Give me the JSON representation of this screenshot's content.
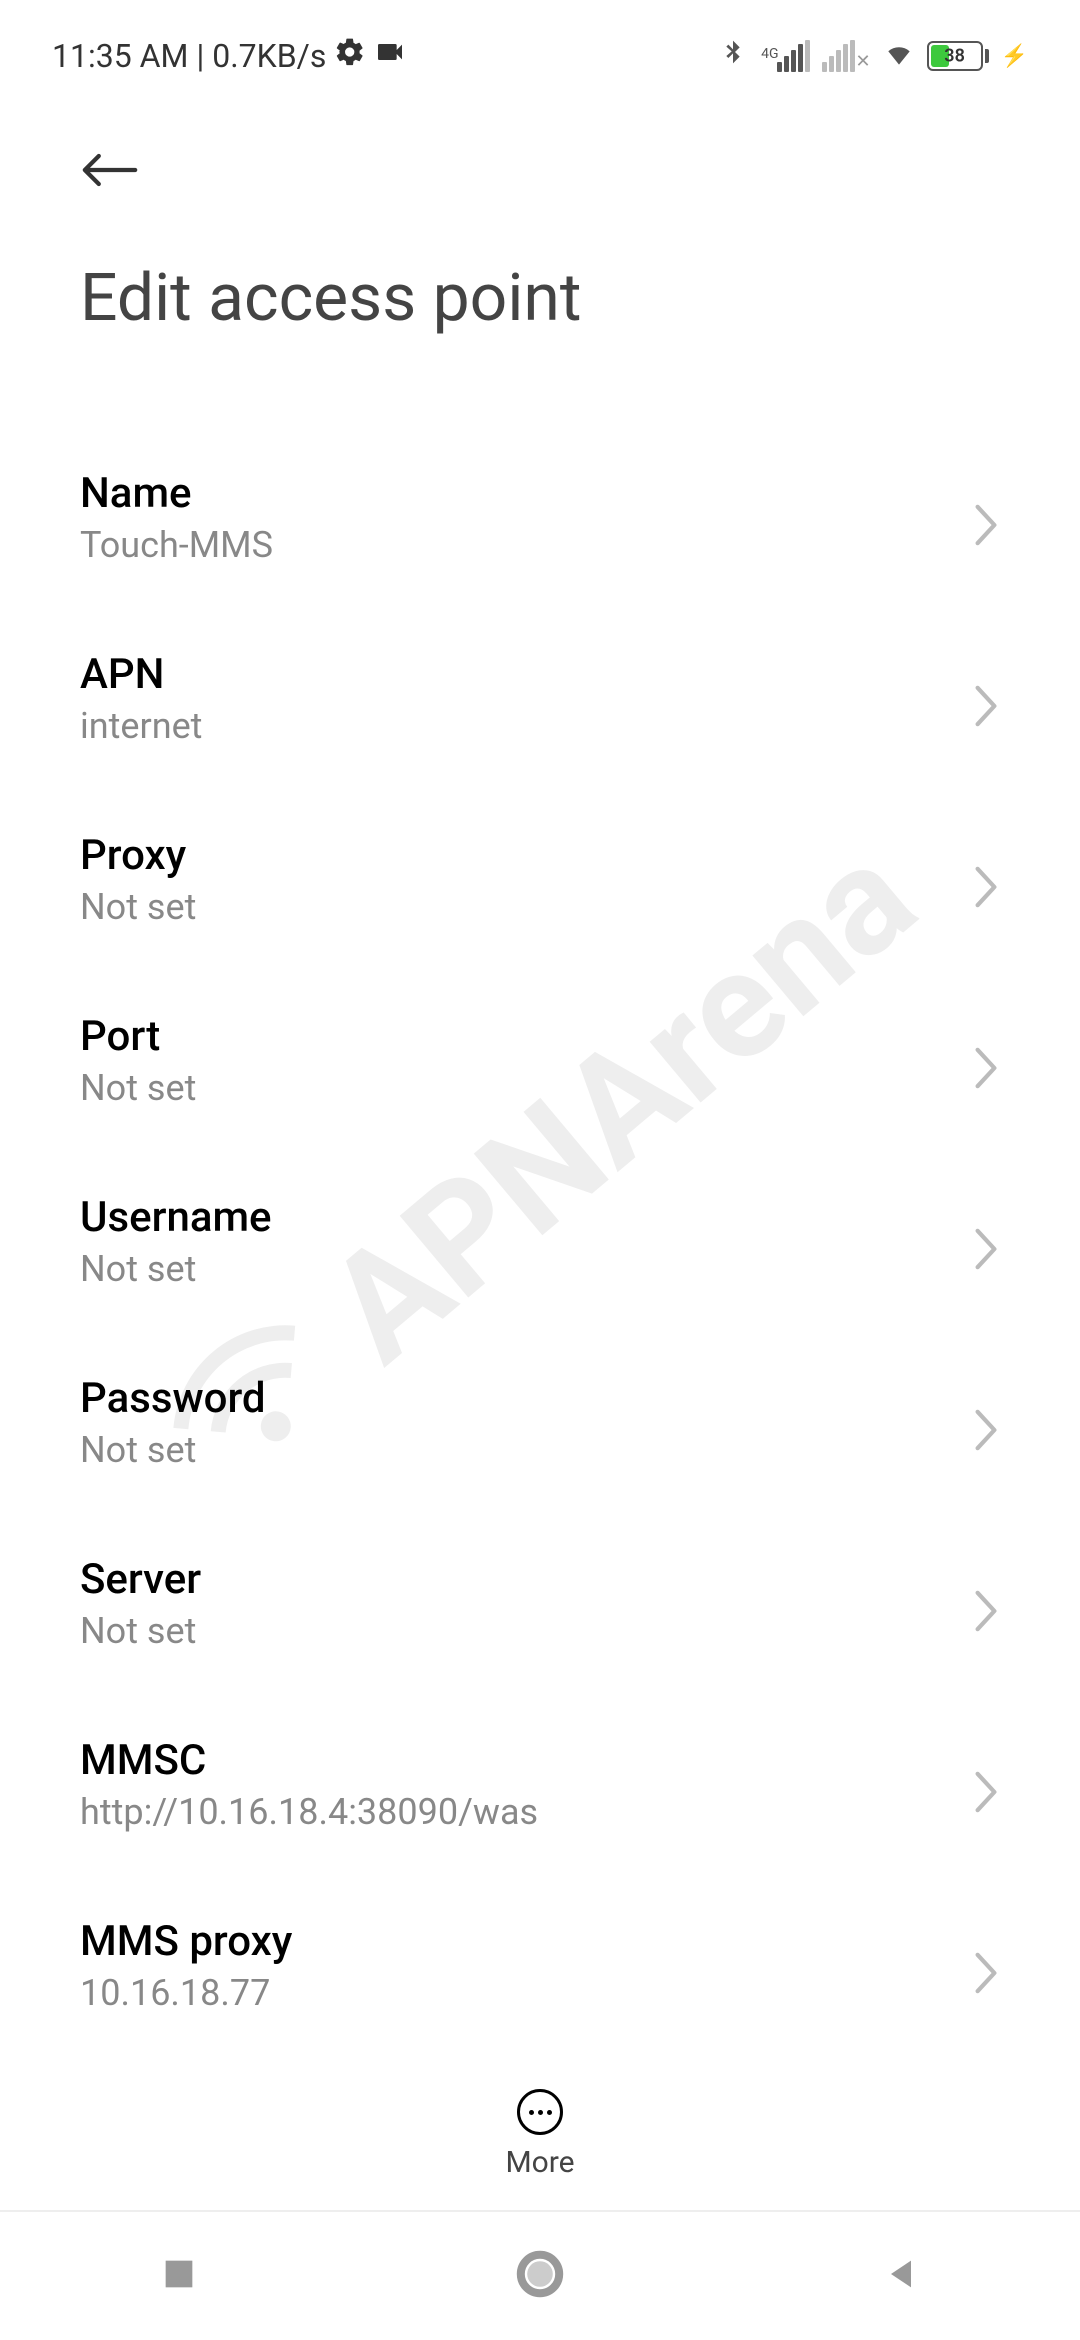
{
  "status": {
    "time": "11:35 AM",
    "speed": "0.7KB/s",
    "network_label": "4G",
    "battery_pct": "38"
  },
  "header": {
    "title": "Edit access point"
  },
  "settings": [
    {
      "label": "Name",
      "value": "Touch-MMS"
    },
    {
      "label": "APN",
      "value": "internet"
    },
    {
      "label": "Proxy",
      "value": "Not set"
    },
    {
      "label": "Port",
      "value": "Not set"
    },
    {
      "label": "Username",
      "value": "Not set"
    },
    {
      "label": "Password",
      "value": "Not set"
    },
    {
      "label": "Server",
      "value": "Not set"
    },
    {
      "label": "MMSC",
      "value": "http://10.16.18.4:38090/was"
    },
    {
      "label": "MMS proxy",
      "value": "10.16.18.77"
    }
  ],
  "bottom": {
    "more_label": "More"
  },
  "watermark": {
    "text": "APNArena"
  }
}
